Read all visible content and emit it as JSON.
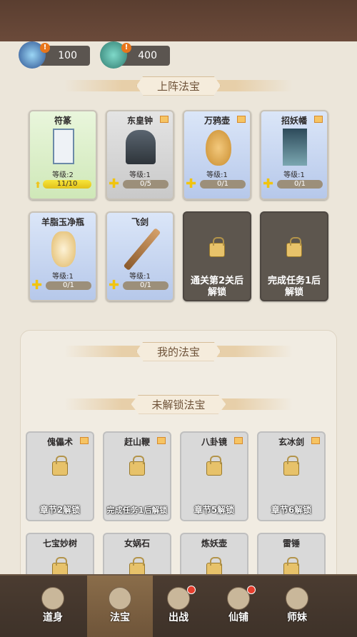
{
  "resources": [
    {
      "name": "crystal-gem",
      "value": "100"
    },
    {
      "name": "jade-scroll",
      "value": "400"
    }
  ],
  "deployed": {
    "title": "上阵法宝",
    "cards": [
      {
        "name": "符篆",
        "level": "等级:2",
        "progress": "11/10",
        "progress_fraction": 1.0,
        "rarity": "green",
        "icon": "talisman-icon"
      },
      {
        "name": "东皇钟",
        "level": "等级:1",
        "progress": "0/5",
        "progress_fraction": 0,
        "rarity": "grey",
        "icon": "bell-icon"
      },
      {
        "name": "万鸦壶",
        "level": "等级:1",
        "progress": "0/1",
        "progress_fraction": 0,
        "rarity": "blue",
        "icon": "gourd-icon"
      },
      {
        "name": "招妖幡",
        "level": "等级:1",
        "progress": "0/1",
        "progress_fraction": 0,
        "rarity": "blue",
        "icon": "banner-icon"
      },
      {
        "name": "羊脂玉净瓶",
        "level": "等级:1",
        "progress": "0/1",
        "progress_fraction": 0,
        "rarity": "blue",
        "icon": "vase-icon"
      },
      {
        "name": "飞剑",
        "level": "等级:1",
        "progress": "0/1",
        "progress_fraction": 0,
        "rarity": "blue",
        "icon": "sword-icon"
      }
    ],
    "locked_slots": [
      {
        "line1": "通关第2关后",
        "line2": "解锁"
      },
      {
        "line1": "完成任务1后",
        "line2": "解锁"
      }
    ]
  },
  "my_treasures": {
    "title": "我的法宝"
  },
  "unlockable": {
    "title": "未解锁法宝",
    "cards": [
      {
        "name": "傀儡术",
        "status": "章节2解锁",
        "icon": "puppet-icon"
      },
      {
        "name": "赶山鞭",
        "status": "完成任务1后解锁",
        "icon": "whip-icon"
      },
      {
        "name": "八卦镜",
        "status": "章节5解锁",
        "icon": "mirror-icon"
      },
      {
        "name": "玄冰剑",
        "status": "章节6解锁",
        "icon": "ice-sword-icon"
      },
      {
        "name": "七宝妙树",
        "status": "",
        "icon": "tree-icon"
      },
      {
        "name": "女娲石",
        "status": "",
        "icon": "stone-icon"
      },
      {
        "name": "炼妖壶",
        "status": "",
        "icon": "pot-icon"
      },
      {
        "name": "雷锤",
        "status": "",
        "icon": "hammer-icon"
      }
    ]
  },
  "nav": {
    "items": [
      {
        "label": "道身",
        "icon": "body-icon",
        "active": false,
        "badge": false
      },
      {
        "label": "法宝",
        "icon": "treasure-icon",
        "active": true,
        "badge": false
      },
      {
        "label": "出战",
        "icon": "battle-icon",
        "active": false,
        "badge": true
      },
      {
        "label": "仙铺",
        "icon": "shop-icon",
        "active": false,
        "badge": true
      },
      {
        "label": "师妹",
        "icon": "companion-icon",
        "active": false,
        "badge": false
      }
    ]
  }
}
